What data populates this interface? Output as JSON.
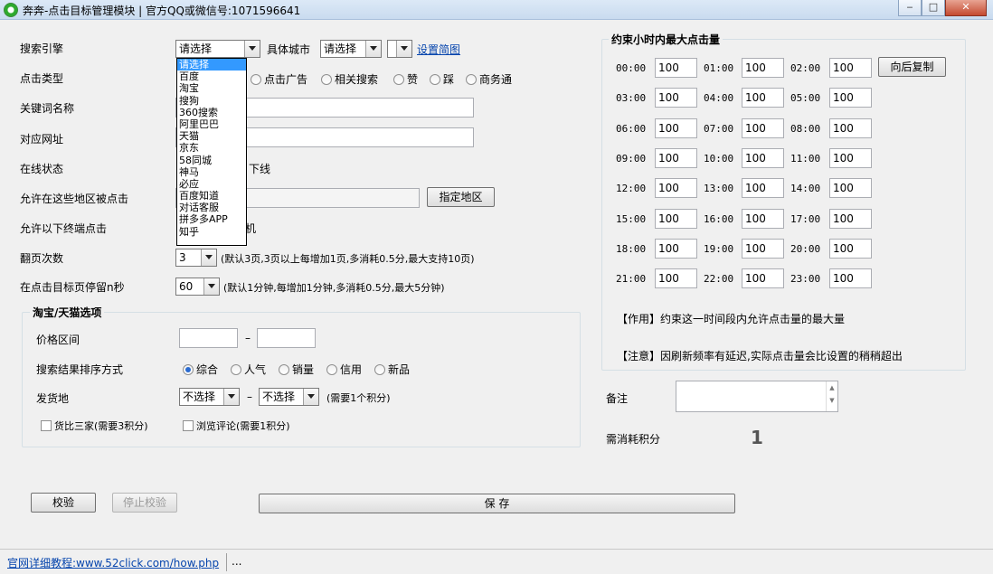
{
  "window": {
    "title": "奔奔-点击目标管理模块 | 官方QQ或微信号:1071596641",
    "minimize": "‒",
    "maximize": "□",
    "close": "✕"
  },
  "form": {
    "search_engine": {
      "label": "搜索引擎",
      "value": "请选择",
      "options": [
        "请选择",
        "百度",
        "淘宝",
        "搜狗",
        "360搜索",
        "阿里巴巴",
        "天猫",
        "京东",
        "58同城",
        "神马",
        "必应",
        "百度知道",
        "对话客服",
        "拼多多APP",
        "知乎"
      ]
    },
    "city": {
      "label": "具体城市",
      "value": "请选择",
      "value2": "",
      "link": "设置简图"
    },
    "click_type": {
      "label": "点击类型",
      "options": [
        "点击广告",
        "相关搜索",
        "赞",
        "踩",
        "商务通"
      ]
    },
    "keyword": {
      "label": "关键词名称",
      "value": ""
    },
    "url": {
      "label": "对应网址",
      "value": ""
    },
    "online": {
      "label": "在线状态",
      "value_suffix": "下线"
    },
    "region": {
      "label": "允许在这些地区被点击",
      "value": "",
      "button": "指定地区"
    },
    "terminal": {
      "label": "允许以下终端点击",
      "value_suffix": "机"
    },
    "pages": {
      "label": "翻页次数",
      "value": "3",
      "note": "(默认3页,3页以上每增加1页,多消耗0.5分,最大支持10页)"
    },
    "stay": {
      "label": "在点击目标页停留n秒",
      "value": "60",
      "note": "(默认1分钟,每增加1分钟,多消耗0.5分,最大5分钟)"
    }
  },
  "taobao": {
    "title": "淘宝/天猫选项",
    "price_label": "价格区间",
    "price_sep": "–",
    "sort_label": "搜索结果排序方式",
    "sort_options": [
      "综合",
      "人气",
      "销量",
      "信用",
      "新品"
    ],
    "ship_label": "发货地",
    "ship_from": "不选择",
    "ship_sep": "–",
    "ship_to": "不选择",
    "ship_note": "(需要1个积分)",
    "compare_label": "货比三家(需要3积分)",
    "review_label": "浏览评论(需要1积分)"
  },
  "hourly": {
    "title": "约束小时内最大点击量",
    "copy_button": "向后复制",
    "slots": [
      {
        "time": "00:00",
        "value": "100"
      },
      {
        "time": "01:00",
        "value": "100"
      },
      {
        "time": "02:00",
        "value": "100"
      },
      {
        "time": "03:00",
        "value": "100"
      },
      {
        "time": "04:00",
        "value": "100"
      },
      {
        "time": "05:00",
        "value": "100"
      },
      {
        "time": "06:00",
        "value": "100"
      },
      {
        "time": "07:00",
        "value": "100"
      },
      {
        "time": "08:00",
        "value": "100"
      },
      {
        "time": "09:00",
        "value": "100"
      },
      {
        "time": "10:00",
        "value": "100"
      },
      {
        "time": "11:00",
        "value": "100"
      },
      {
        "time": "12:00",
        "value": "100"
      },
      {
        "time": "13:00",
        "value": "100"
      },
      {
        "time": "14:00",
        "value": "100"
      },
      {
        "time": "15:00",
        "value": "100"
      },
      {
        "time": "16:00",
        "value": "100"
      },
      {
        "time": "17:00",
        "value": "100"
      },
      {
        "time": "18:00",
        "value": "100"
      },
      {
        "time": "19:00",
        "value": "100"
      },
      {
        "time": "20:00",
        "value": "100"
      },
      {
        "time": "21:00",
        "value": "100"
      },
      {
        "time": "22:00",
        "value": "100"
      },
      {
        "time": "23:00",
        "value": "100"
      }
    ],
    "note_effect": "【作用】约束这一时间段内允许点击量的最大量",
    "note_warning": "【注意】因刷新频率有延迟,实际点击量会比设置的稍稍超出"
  },
  "remark": {
    "label": "备注",
    "value": ""
  },
  "points": {
    "label": "需消耗积分",
    "value": "1"
  },
  "actions": {
    "verify": "校验",
    "stop_verify": "停止校验",
    "save": "保 存"
  },
  "status": {
    "link": "官网详细教程:www.52click.com/how.php",
    "extra": "..."
  }
}
